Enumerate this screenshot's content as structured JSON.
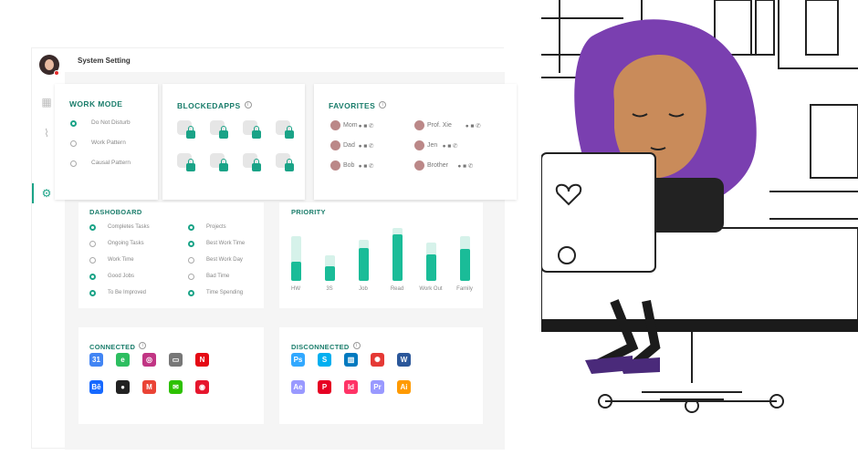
{
  "app": {
    "title": "System Setting"
  },
  "work_mode": {
    "title": "WORK MODE",
    "options": [
      {
        "label": "Do Not Disturb",
        "selected": true
      },
      {
        "label": "Work Pattern",
        "selected": false
      },
      {
        "label": "Causal Pattern",
        "selected": false
      }
    ]
  },
  "blocked_apps": {
    "title": "BLOCKEDAPPS",
    "count": 8
  },
  "favorites": {
    "title": "FAVORITES",
    "contacts": [
      {
        "name": "Mom"
      },
      {
        "name": "Prof. Xie"
      },
      {
        "name": "Dad"
      },
      {
        "name": "Jen"
      },
      {
        "name": "Bob"
      },
      {
        "name": "Brother"
      }
    ]
  },
  "dashboard": {
    "title": "DASHOBOARD",
    "left": [
      {
        "label": "Completes Tasks",
        "selected": true
      },
      {
        "label": "Ongoing Tasks",
        "selected": false
      },
      {
        "label": "Work Time",
        "selected": false
      },
      {
        "label": "Good Jobs",
        "selected": true
      },
      {
        "label": "To Be Improved",
        "selected": true
      }
    ],
    "right": [
      {
        "label": "Projects",
        "selected": true
      },
      {
        "label": "Best Work Time",
        "selected": true
      },
      {
        "label": "Best Work Day",
        "selected": false
      },
      {
        "label": "Bad Time",
        "selected": false
      },
      {
        "label": "Time Spending",
        "selected": true
      }
    ]
  },
  "priority": {
    "title": "PRIORITY",
    "items": [
      {
        "label": "HW",
        "total": 0.85,
        "value": 0.36
      },
      {
        "label": "3S",
        "total": 0.48,
        "value": 0.28
      },
      {
        "label": "Job",
        "total": 0.78,
        "value": 0.62
      },
      {
        "label": "Read",
        "total": 1.0,
        "value": 0.88
      },
      {
        "label": "Work Out",
        "total": 0.72,
        "value": 0.5
      },
      {
        "label": "Family",
        "total": 0.85,
        "value": 0.6
      }
    ]
  },
  "connected": {
    "title": "CONNECTED",
    "apps": [
      {
        "icon": "google-calendar-icon",
        "glyph": "31",
        "color": "#4285f4"
      },
      {
        "icon": "evernote-icon",
        "glyph": "e",
        "color": "#2dbe60"
      },
      {
        "icon": "instagram-icon",
        "glyph": "◎",
        "color": "#c13584"
      },
      {
        "icon": "tv-icon",
        "glyph": "▭",
        "color": "#777777"
      },
      {
        "icon": "netflix-icon",
        "glyph": "N",
        "color": "#e50914"
      },
      {
        "icon": "behance-icon",
        "glyph": "Bē",
        "color": "#1769ff"
      },
      {
        "icon": "github-icon",
        "glyph": "●",
        "color": "#222222"
      },
      {
        "icon": "gmail-icon",
        "glyph": "M",
        "color": "#ea4335"
      },
      {
        "icon": "wechat-icon",
        "glyph": "✉",
        "color": "#2dc100"
      },
      {
        "icon": "weibo-icon",
        "glyph": "◉",
        "color": "#e6162d"
      }
    ]
  },
  "disconnected": {
    "title": "DISCONNECTED",
    "apps": [
      {
        "icon": "photoshop-icon",
        "glyph": "Ps",
        "color": "#31a8ff"
      },
      {
        "icon": "skype-icon",
        "glyph": "S",
        "color": "#00aff0"
      },
      {
        "icon": "trello-icon",
        "glyph": "▥",
        "color": "#0079bf"
      },
      {
        "icon": "aperture-icon",
        "glyph": "✺",
        "color": "#e53935"
      },
      {
        "icon": "word-icon",
        "glyph": "W",
        "color": "#2b579a"
      },
      {
        "icon": "after-effects-icon",
        "glyph": "Ae",
        "color": "#9999ff"
      },
      {
        "icon": "pinterest-icon",
        "glyph": "P",
        "color": "#e60023"
      },
      {
        "icon": "indesign-icon",
        "glyph": "Id",
        "color": "#ff3366"
      },
      {
        "icon": "premiere-icon",
        "glyph": "Pr",
        "color": "#9999ff"
      },
      {
        "icon": "illustrator-icon",
        "glyph": "Ai",
        "color": "#ff9a00"
      }
    ]
  },
  "colors": {
    "accent": "#1aa387",
    "bar_light": "#d6f2ea",
    "bar": "#1abc98",
    "hair": "#6a2fa0"
  }
}
